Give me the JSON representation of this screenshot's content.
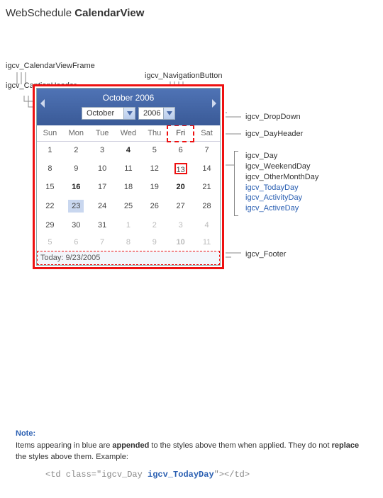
{
  "title": {
    "prefix": "WebSchedule ",
    "bold": "CalendarView"
  },
  "labels": {
    "frame": "igcv_CalendarViewFrame",
    "caption": "igcv_CaptionHeader",
    "navbutton": "igcv_NavigationButton",
    "dropdown": "igcv_DropDown",
    "dayheader": "igcv_DayHeader",
    "day_group": {
      "day": "igcv_Day",
      "weekend": "igcv_WeekendDay",
      "other": "igcv_OtherMonthDay",
      "today": "igcv_TodayDay",
      "activity": "igcv_ActivityDay",
      "active": "igcv_ActiveDay"
    },
    "footer": "igcv_Footer"
  },
  "calendar": {
    "title": "October 2006",
    "month_value": "October",
    "year_value": "2006",
    "day_headers": [
      "Sun",
      "Mon",
      "Tue",
      "Wed",
      "Thu",
      "Fri",
      "Sat"
    ],
    "rows": [
      [
        {
          "v": "1"
        },
        {
          "v": "2"
        },
        {
          "v": "3"
        },
        {
          "v": "4",
          "b": true
        },
        {
          "v": "5"
        },
        {
          "v": "6"
        },
        {
          "v": "7"
        }
      ],
      [
        {
          "v": "8"
        },
        {
          "v": "9"
        },
        {
          "v": "10"
        },
        {
          "v": "11"
        },
        {
          "v": "12"
        },
        {
          "v": "13",
          "today": true
        },
        {
          "v": "14"
        }
      ],
      [
        {
          "v": "15"
        },
        {
          "v": "16",
          "b": true
        },
        {
          "v": "17"
        },
        {
          "v": "18"
        },
        {
          "v": "19"
        },
        {
          "v": "20",
          "b": true
        },
        {
          "v": "21"
        }
      ],
      [
        {
          "v": "22"
        },
        {
          "v": "23",
          "active": true
        },
        {
          "v": "24"
        },
        {
          "v": "25"
        },
        {
          "v": "26"
        },
        {
          "v": "27"
        },
        {
          "v": "28"
        }
      ],
      [
        {
          "v": "29"
        },
        {
          "v": "30"
        },
        {
          "v": "31"
        },
        {
          "v": "1",
          "o": true
        },
        {
          "v": "2",
          "o": true
        },
        {
          "v": "3",
          "o": true
        },
        {
          "v": "4",
          "o": true
        }
      ],
      [
        {
          "v": "5",
          "o": true
        },
        {
          "v": "6",
          "o": true
        },
        {
          "v": "7",
          "o": true
        },
        {
          "v": "8",
          "o": true
        },
        {
          "v": "9",
          "o": true
        },
        {
          "v": "10",
          "o": true,
          "b": true
        },
        {
          "v": "11",
          "o": true
        }
      ]
    ],
    "footer": "Today: 9/23/2005"
  },
  "note": {
    "header": "Note:",
    "body_pre": "Items appearing in blue are ",
    "body_b1": "appended",
    "body_mid": " to the styles above them when applied. They do not ",
    "body_b2": "replace",
    "body_post": " the styles above them. Example:",
    "code_pre": "<td class=\"igcv_Day ",
    "code_hl": "igcv_TodayDay",
    "code_post": "\"></td>"
  }
}
